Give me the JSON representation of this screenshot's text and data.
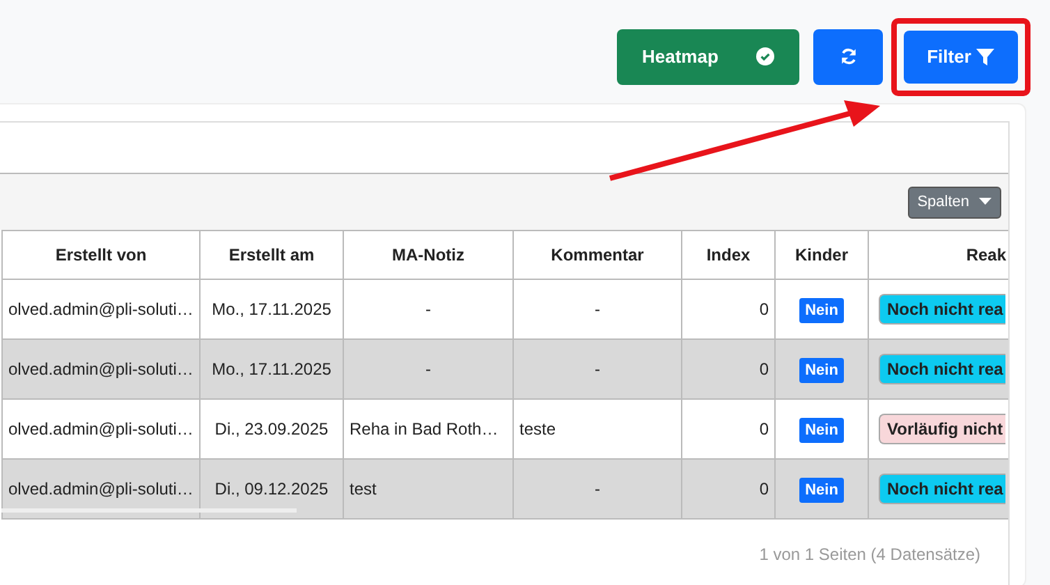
{
  "toolbar": {
    "buttons": [
      {
        "kind": "heatmap",
        "label": "Heatmap",
        "checked": true
      },
      {
        "kind": "refresh"
      },
      {
        "kind": "filter",
        "label": "Filter",
        "highlighted": true
      }
    ]
  },
  "table": {
    "columns_button": "Spalten",
    "columns": [
      "Erstellt von",
      "Erstellt am",
      "MA-Notiz",
      "Kommentar",
      "Index",
      "Kinder",
      "Reak"
    ],
    "rows": [
      {
        "created_by": "olved.admin@pli-soluti…",
        "created_at": "Mo., 17.11.2025",
        "note": "-",
        "comment": "-",
        "index": "0",
        "children": "Nein",
        "status": "Noch nicht rea",
        "color": "#0dcaf0"
      },
      {
        "created_by": "olved.admin@pli-soluti…",
        "created_at": "Mo., 17.11.2025",
        "note": "-",
        "comment": "-",
        "index": "0",
        "children": "Nein",
        "status": "Noch nicht rea",
        "color": "#0dcaf0"
      },
      {
        "created_by": "olved.admin@pli-soluti…",
        "created_at": "Di., 23.09.2025",
        "note": "Reha in Bad Roth…",
        "comment": "teste",
        "index": "0",
        "children": "Nein",
        "status": "Vorläufig nicht",
        "color": "#f8d7da"
      },
      {
        "created_by": "olved.admin@pli-soluti…",
        "created_at": "Di., 09.12.2025",
        "note": "test",
        "comment": "-",
        "index": "0",
        "children": "Nein",
        "status": "Noch nicht rea",
        "color": "#0dcaf0"
      }
    ]
  },
  "pagination": "1 von 1 Seiten (4 Datensätze)"
}
